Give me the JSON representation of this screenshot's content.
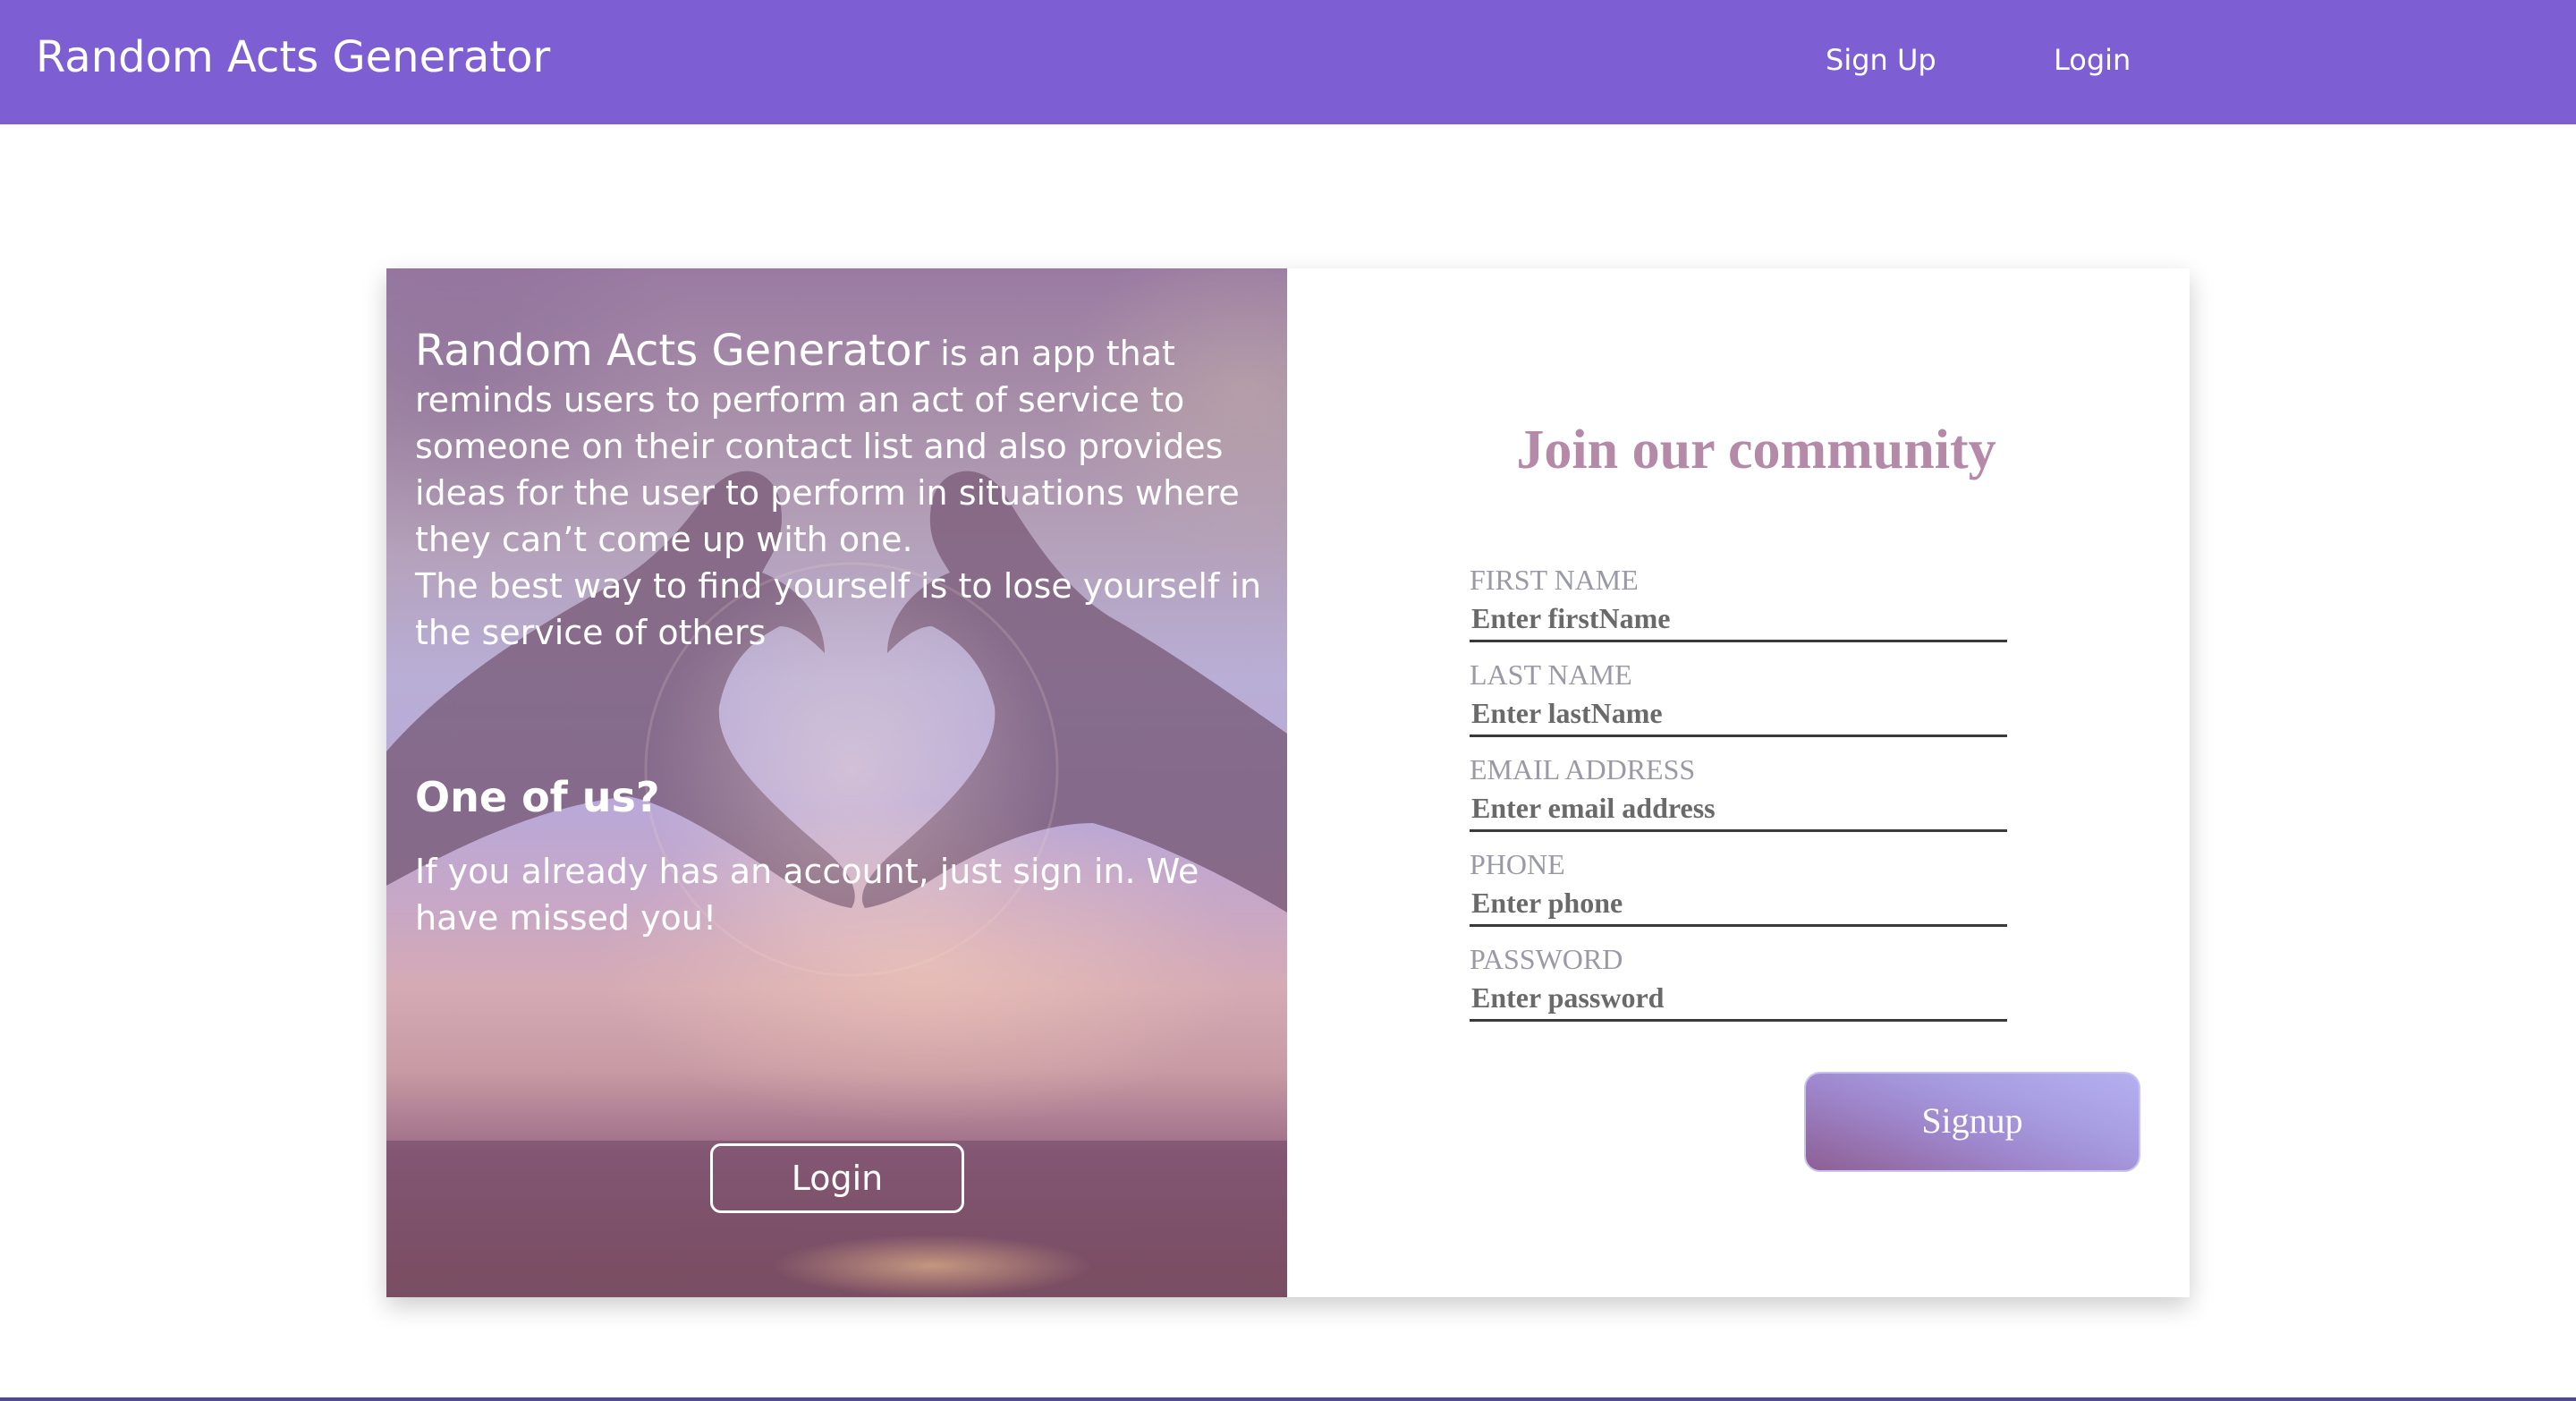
{
  "navbar": {
    "brand": "Random Acts Generator",
    "links": {
      "signup": "Sign Up",
      "login": "Login"
    },
    "background_color": "#7d5fd3"
  },
  "left_panel": {
    "intro_brand": "Random Acts Generator",
    "intro_text": " is an app that reminds users to perform an act of service to someone on their contact list and also provides ideas for the user to perform in situations where they can’t come up with one.",
    "quote": "The best way to find yourself is to lose yourself in the service of others",
    "heading": "One of us?",
    "subtext": "If you already has an account, just sign in. We have missed you!",
    "login_button": "Login",
    "background_image": "heart-hands-sunset-photo"
  },
  "form": {
    "title": "Join our community",
    "title_color": "#b58aa9",
    "fields": [
      {
        "label": "FIRST NAME",
        "placeholder": "Enter firstName",
        "value": ""
      },
      {
        "label": "LAST NAME",
        "placeholder": "Enter lastName",
        "value": ""
      },
      {
        "label": "EMAIL ADDRESS",
        "placeholder": "Enter email address",
        "value": ""
      },
      {
        "label": "PHONE",
        "placeholder": "Enter phone",
        "value": ""
      },
      {
        "label": "PASSWORD",
        "placeholder": "Enter password",
        "value": ""
      }
    ],
    "submit_label": "Signup"
  }
}
